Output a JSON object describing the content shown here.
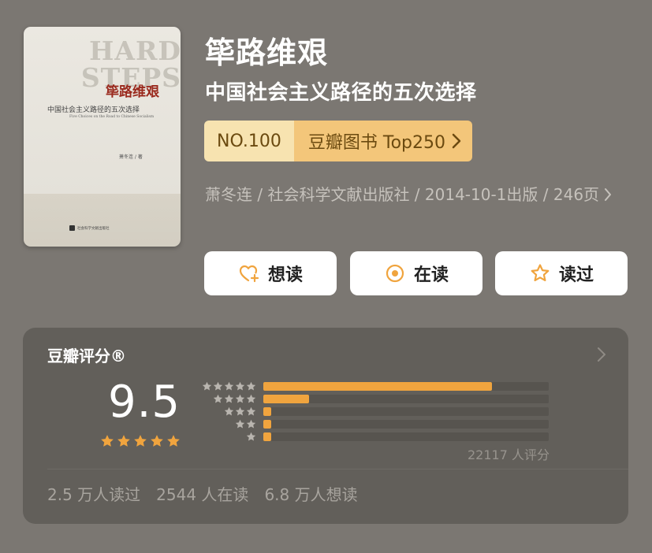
{
  "book": {
    "title": "筚路维艰",
    "subtitle": "中国社会主义路径的五次选择",
    "cover": {
      "bg_text": "HARD\nSTEPS",
      "title": "筚路维艰",
      "subtitle": "中国社会主义路径的五次选择",
      "english": "Five Choices on the Road to Chinese Socialism",
      "author": "萧冬连 / 著",
      "publisher": "社会科学文献出版社"
    }
  },
  "ranking": {
    "number": "NO.100",
    "list_name": "豆瓣图书 Top250"
  },
  "meta": {
    "text": "萧冬连 / 社会科学文献出版社 / 2014-10-1出版 / 246页"
  },
  "actions": {
    "want": "想读",
    "reading": "在读",
    "read": "读过"
  },
  "rating": {
    "title": "豆瓣评分®",
    "score": "9.5",
    "stars": 5,
    "distribution": [
      {
        "stars": 5,
        "fraction": 0.8
      },
      {
        "stars": 4,
        "fraction": 0.16
      },
      {
        "stars": 3,
        "fraction": 0.025
      },
      {
        "stars": 2,
        "fraction": 0.025
      },
      {
        "stars": 1,
        "fraction": 0.025
      }
    ],
    "count_text": "22117 人评分",
    "stats": {
      "read": "2.5 万人读过",
      "reading": "2544 人在读",
      "want": "6.8 万人想读"
    }
  },
  "colors": {
    "background": "#7b7772",
    "card": "#625f5a",
    "accent": "#f0a43e",
    "badge_light": "#f7e3b0",
    "badge_dark": "#f3c67a"
  }
}
